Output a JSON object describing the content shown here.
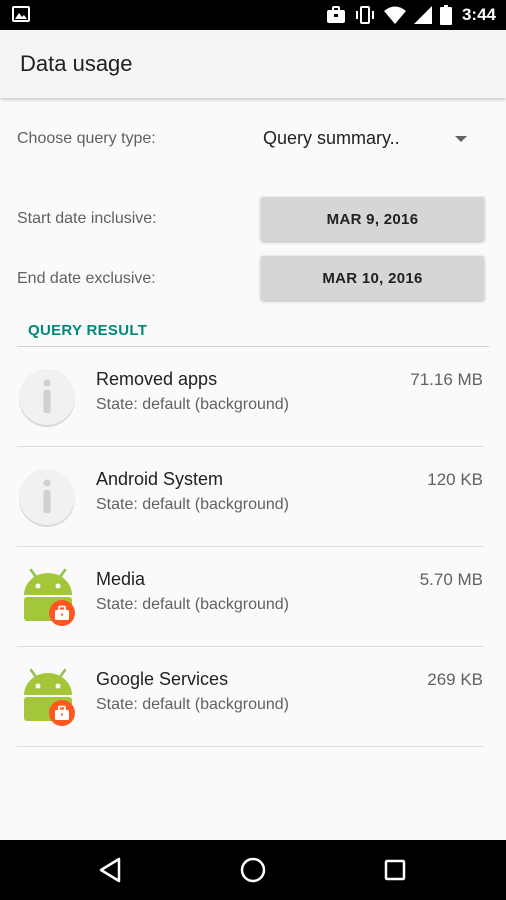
{
  "status_bar": {
    "time": "3:44",
    "icons": [
      "image-icon",
      "briefcase-icon",
      "vibrate-icon",
      "wifi-icon",
      "signal-icon",
      "battery-icon"
    ]
  },
  "app_bar": {
    "title": "Data usage"
  },
  "form": {
    "query_type_label": "Choose query type:",
    "query_type_value": "Query summary..",
    "start_label": "Start date inclusive:",
    "start_value": "MAR 9, 2016",
    "end_label": "End date exclusive:",
    "end_value": "MAR 10, 2016"
  },
  "result": {
    "header": "QUERY RESULT",
    "rows": [
      {
        "name": "Removed apps",
        "state": "State: default (background)",
        "size": "71.16 MB",
        "icon": "generic-app-icon"
      },
      {
        "name": "Android System",
        "state": "State: default (background)",
        "size": "120 KB",
        "icon": "generic-app-icon"
      },
      {
        "name": "Media",
        "state": "State: default (background)",
        "size": "5.70 MB",
        "icon": "android-work-icon"
      },
      {
        "name": "Google Services",
        "state": "State: default (background)",
        "size": "269 KB",
        "icon": "android-work-icon"
      }
    ]
  },
  "colors": {
    "accent": "#00897b",
    "android_green": "#a4c639",
    "work_badge": "#ff5722"
  },
  "nav_bar": {
    "items": [
      "back-icon",
      "home-icon",
      "recents-icon"
    ]
  }
}
